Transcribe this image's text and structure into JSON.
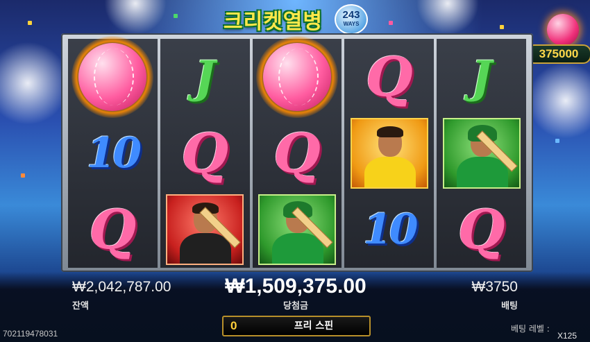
{
  "game": {
    "logo_text": "크리켓열병",
    "ways_number": "243",
    "ways_label": "WAYS"
  },
  "jackpot": {
    "value": "375000"
  },
  "reels": [
    [
      "ball",
      "10",
      "Q"
    ],
    [
      "J",
      "Q",
      "red-batsman"
    ],
    [
      "ball",
      "Q",
      "green-batsman"
    ],
    [
      "Q",
      "yellow-captain",
      "10"
    ],
    [
      "J",
      "green-batsman",
      "Q"
    ]
  ],
  "balance": {
    "value": "₩2,042,787.00",
    "label": "잔액"
  },
  "win": {
    "value": "₩1,509,375.00",
    "label": "당첨금"
  },
  "bet": {
    "value": "₩3750",
    "label": "배팅"
  },
  "free_spins": {
    "count": "0",
    "label": "프리 스핀"
  },
  "session_id": "702119478031",
  "bet_level": {
    "label": "베팅 레벨 :",
    "value": "X125"
  },
  "colors": {
    "accent_gold": "#e8c24a",
    "jackpot_text": "#ffd84a"
  }
}
